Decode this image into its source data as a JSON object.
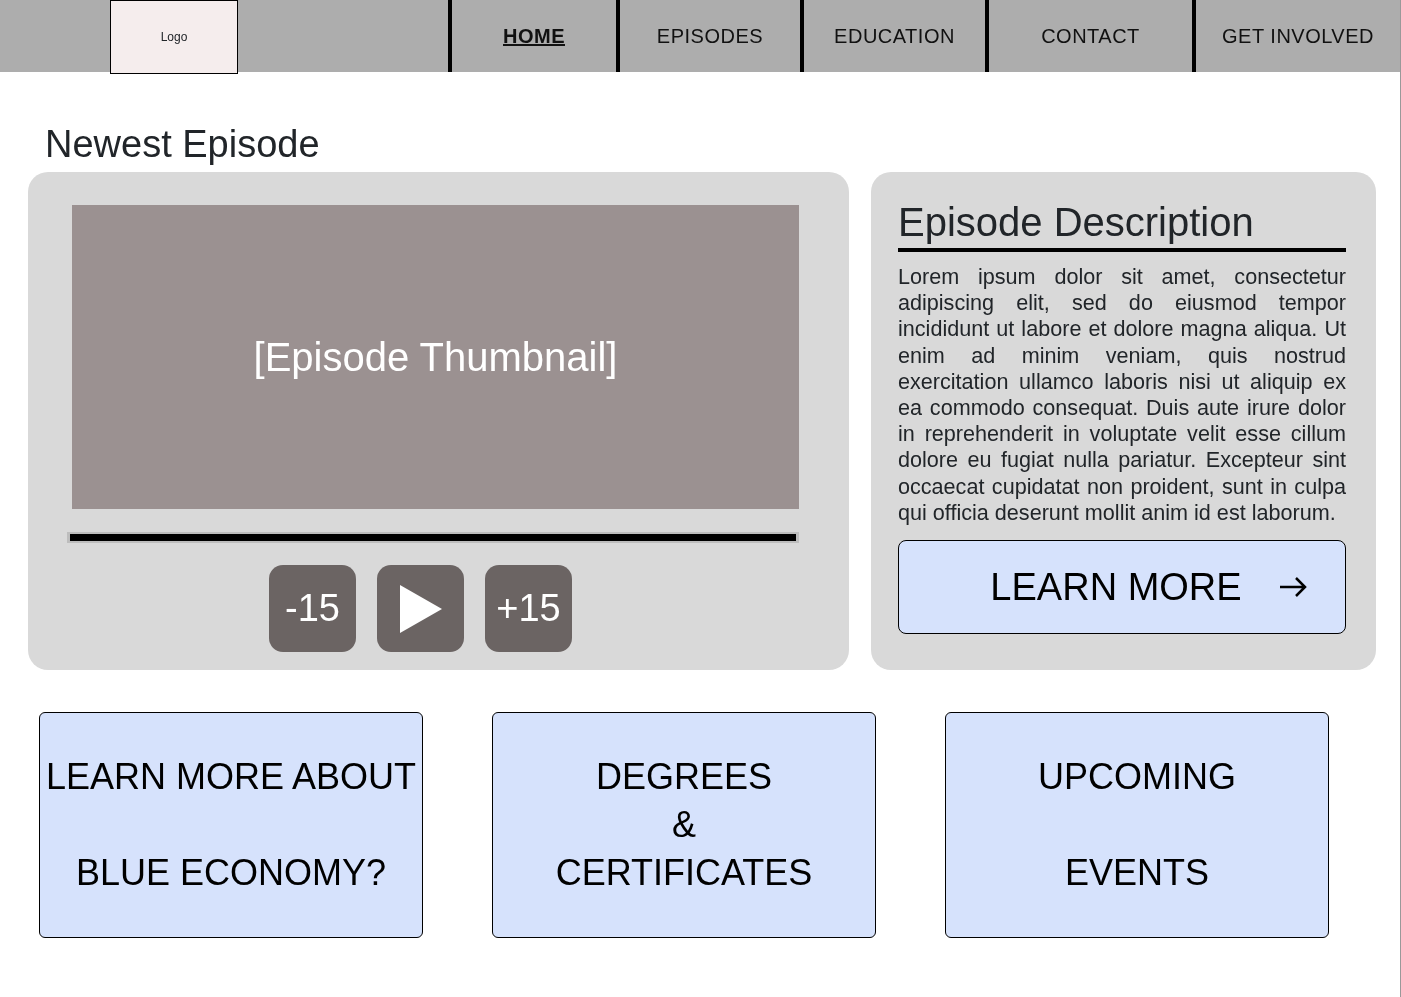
{
  "header": {
    "logo": "Logo",
    "nav": [
      {
        "label": "HOME",
        "selected": true
      },
      {
        "label": "EPISODES",
        "selected": false
      },
      {
        "label": "EDUCATION",
        "selected": false
      },
      {
        "label": "CONTACT",
        "selected": false
      },
      {
        "label": "GET INVOLVED",
        "selected": false
      }
    ]
  },
  "section_title": "Newest Episode",
  "player": {
    "thumbnail": "[Episode Thumbnail]",
    "progress": {
      "level": 1
    },
    "controls": [
      {
        "kind": "text",
        "label": "-15"
      },
      {
        "kind": "play"
      },
      {
        "kind": "text",
        "label": "+15"
      }
    ]
  },
  "description": {
    "title": "Episode Description",
    "text": "Lorem ipsum dolor sit amet, consectetur adipiscing elit, sed do eiusmod tempor incididunt ut labore et dolore magna aliqua. Ut enim ad minim veniam, quis nostrud exercitation ullamco laboris nisi ut aliquip ex ea commodo consequat. Duis aute irure dolor in reprehenderit in voluptate velit esse cillum dolore eu fugiat nulla pariatur. Excepteur sint occaecat cupidatat non proident, sunt in culpa qui officia deserunt mollit anim id est laborum.",
    "button": "LEARN MORE"
  },
  "tiles": [
    {
      "lines": [
        "LEARN MORE ABOUT",
        "BLUE ECONOMY?"
      ]
    },
    {
      "lines": [
        "DEGREES",
        "&",
        "CERTIFICATES"
      ]
    },
    {
      "lines": [
        "UPCOMING",
        "EVENTS"
      ]
    }
  ]
}
